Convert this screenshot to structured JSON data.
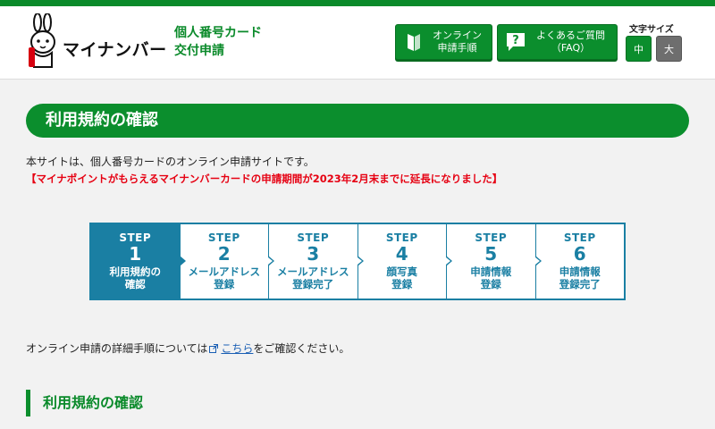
{
  "header": {
    "logo_text": "マイナンバー",
    "service_name_line1": "個人番号カード",
    "service_name_line2": "交付申請",
    "online_procedure_label": "オンライン\n申請手順",
    "faq_label": "よくあるご質問\n（FAQ）",
    "font_size_label": "文字サイズ",
    "font_size_medium": "中",
    "font_size_large": "大"
  },
  "page": {
    "banner_title": "利用規約の確認",
    "intro_text": "本サイトは、個人番号カードのオンライン申請サイトです。",
    "notice_text": "【マイナポイントがもらえるマイナンバーカードの申請期間が2023年2月末までに延長になりました】",
    "detail_text_before": "オンライン申請の詳細手順については",
    "detail_link_text": "こちら",
    "detail_text_after": "をご確認ください。",
    "section_title": "利用規約の確認"
  },
  "steps": [
    {
      "label": "STEP",
      "number": "1",
      "name": "利用規約の\n確認"
    },
    {
      "label": "STEP",
      "number": "2",
      "name": "メールアドレス\n登録"
    },
    {
      "label": "STEP",
      "number": "3",
      "name": "メールアドレス\n登録完了"
    },
    {
      "label": "STEP",
      "number": "4",
      "name": "顔写真\n登録"
    },
    {
      "label": "STEP",
      "number": "5",
      "name": "申請情報\n登録"
    },
    {
      "label": "STEP",
      "number": "6",
      "name": "申請情報\n登録完了"
    }
  ],
  "colors": {
    "brand_green": "#0b8e2d",
    "step_blue": "#1a7fa3",
    "notice_red": "#e60012"
  }
}
